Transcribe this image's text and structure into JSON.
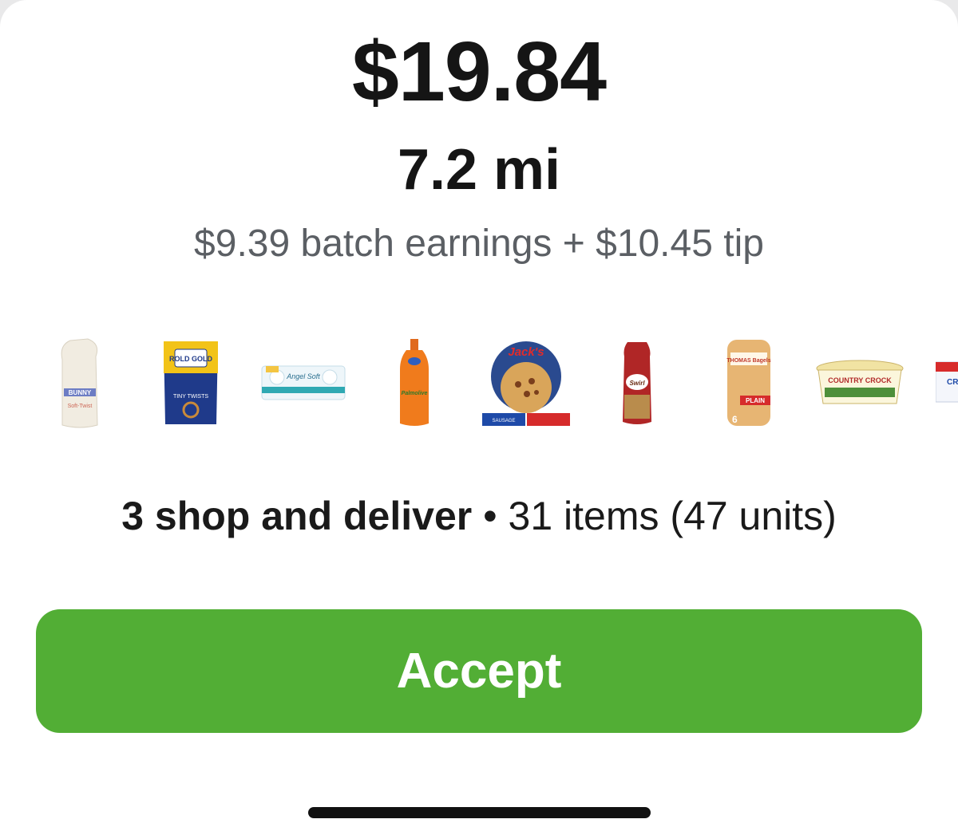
{
  "offer": {
    "price": "$19.84",
    "distance": "7.2 mi",
    "earnings_line": "$9.39 batch earnings + $10.45 tip"
  },
  "summary": {
    "orders_label": "3 shop and deliver",
    "separator": " • ",
    "items_label": "31 items (47 units)"
  },
  "products": [
    {
      "name": "bread-loaf",
      "label": "BUNNY"
    },
    {
      "name": "pretzels",
      "label": "ROLD GOLD"
    },
    {
      "name": "paper-towels",
      "label": "Angel Soft"
    },
    {
      "name": "dish-soap",
      "label": "Palmolive"
    },
    {
      "name": "frozen-pizza",
      "label": "Jack's"
    },
    {
      "name": "swirl-bread",
      "label": "Swirl"
    },
    {
      "name": "bagels",
      "label": "THOMAS Bagels"
    },
    {
      "name": "butter-spread",
      "label": "COUNTRY CROCK"
    },
    {
      "name": "partial-product",
      "label": "CR"
    }
  ],
  "actions": {
    "accept_label": "Accept"
  },
  "colors": {
    "accept_bg": "#52ae35",
    "secondary_text": "#5b5f64"
  }
}
